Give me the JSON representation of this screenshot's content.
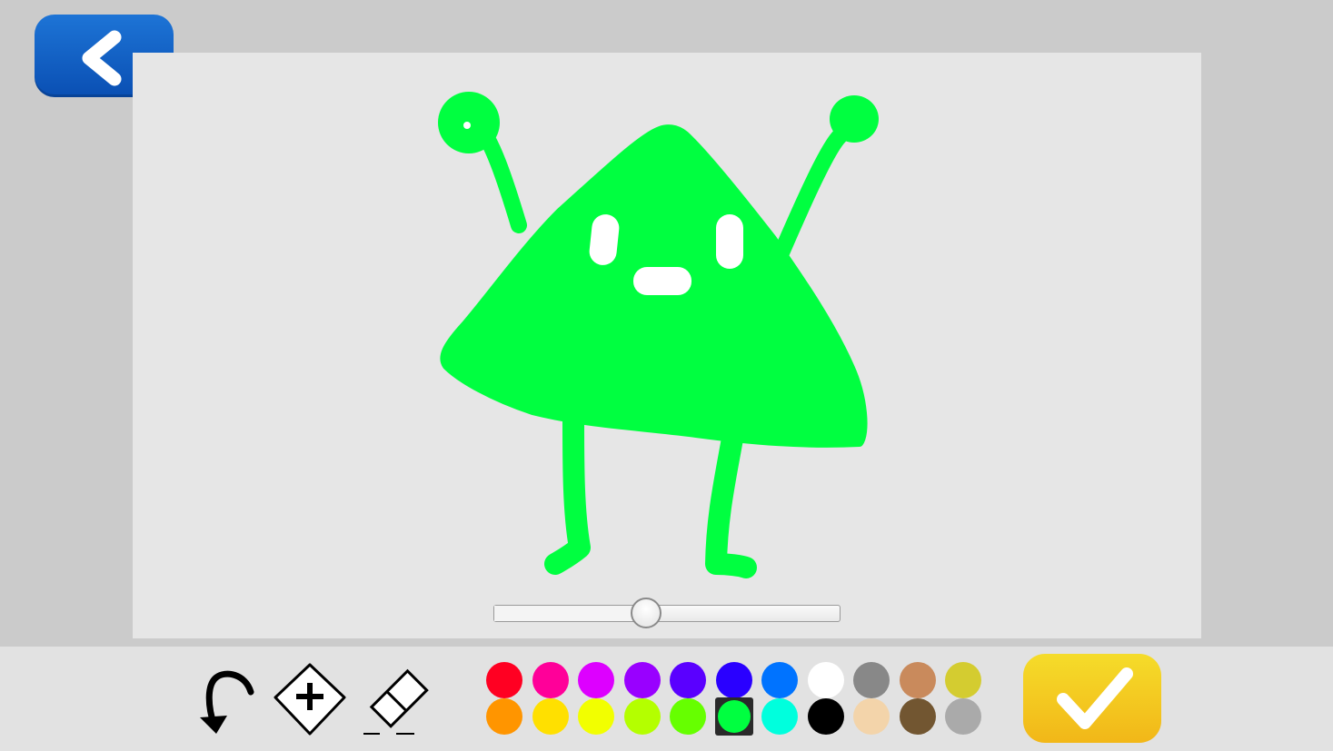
{
  "icons": {
    "back": "chevron-left-icon",
    "undo": "undo-arrow-icon",
    "add_layer": "add-layer-icon",
    "eraser": "eraser-icon",
    "confirm": "checkmark-icon"
  },
  "colors": {
    "back_button": "#0a5fc8",
    "confirm_button": "#f4c820",
    "canvas_bg": "#e6e6e6",
    "stroke": "#00ff40"
  },
  "brush_size_slider": {
    "value_fraction": 0.44
  },
  "palette": {
    "selected": "#00ff40",
    "top_row": [
      "#ff0022",
      "#ff0099",
      "#dd00ff",
      "#9900ff",
      "#5a00ff",
      "#2a00ff",
      "#0073ff",
      "#ffffff",
      "#888888",
      "#c98a5c",
      "#d4cc30"
    ],
    "bottom_row": [
      "#ff9500",
      "#ffe000",
      "#f2ff00",
      "#b4ff00",
      "#66ff00",
      "#00ff40",
      "#00ffdd",
      "#000000",
      "#f3d4aa",
      "#725631",
      "#aaaaaa"
    ]
  }
}
